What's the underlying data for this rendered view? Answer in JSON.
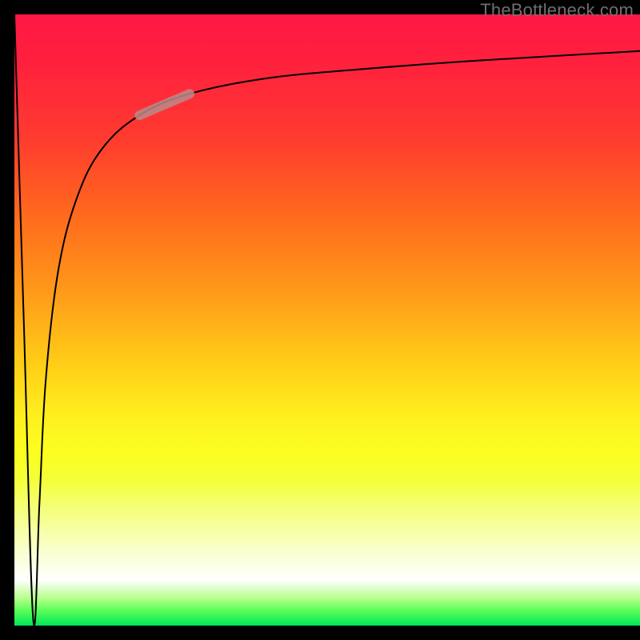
{
  "attribution": "TheBottleneck.com",
  "colors": {
    "frame": "#000000",
    "curve": "#000000",
    "highlight": "#bb8a8a",
    "gradient_top": "#ff1744",
    "gradient_mid": "#fff01f",
    "gradient_bottom": "#00e658"
  },
  "chart_data": {
    "type": "line",
    "title": "",
    "xlabel": "",
    "ylabel": "",
    "xlim": [
      0,
      100
    ],
    "ylim": [
      0,
      100
    ],
    "description": "Bottleneck percentage curve: starts near 100 at x=0, drops to ~0 at x≈3, then rises asymptotically toward ~94 as x→100. Background vertical gradient encodes severity (red=high, green=low).",
    "series": [
      {
        "name": "bottleneck-curve",
        "x": [
          0,
          1.5,
          3,
          4,
          5,
          7,
          10,
          14,
          20,
          28,
          40,
          55,
          75,
          100
        ],
        "y": [
          100,
          50,
          1,
          20,
          40,
          58,
          70,
          78,
          83.5,
          87,
          89.5,
          91,
          92.5,
          94
        ]
      }
    ],
    "highlight_segment": {
      "series": "bottleneck-curve",
      "x_start": 20,
      "x_end": 28
    }
  }
}
